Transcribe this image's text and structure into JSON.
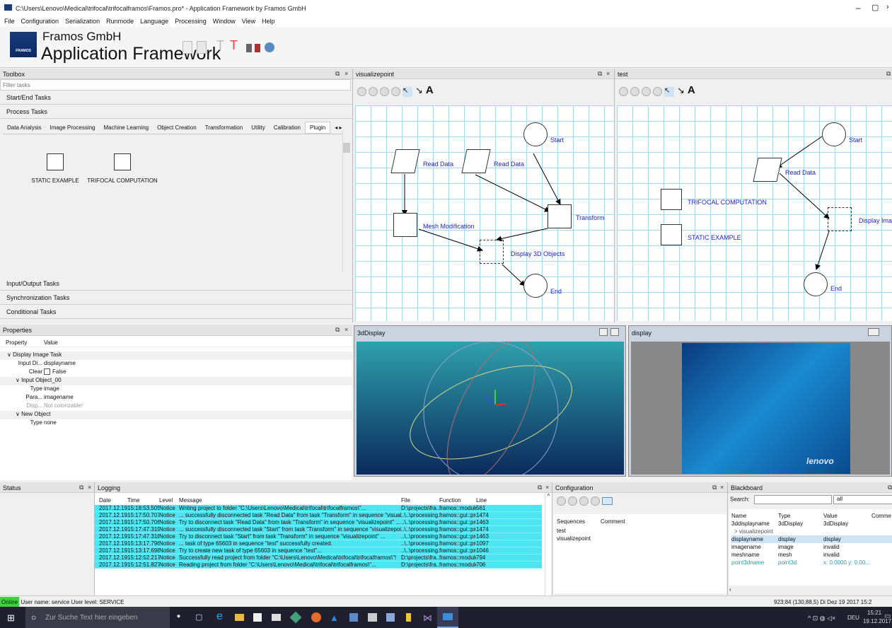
{
  "window": {
    "title": "C:\\Users\\Lenovo\\Medical\\trifocal\\trifocalframos\\Framos.pro* - Application Framework by Framos GmbH"
  },
  "menu": [
    "File",
    "Configuration",
    "Serialization",
    "Runmode",
    "Language",
    "Processing",
    "Window",
    "View",
    "Help"
  ],
  "brand": {
    "company": "Framos GmbH",
    "app": "Application Framework",
    "logo_text": "FRAMOS"
  },
  "toolbox": {
    "title": "Toolbox",
    "filter_placeholder": "Filter tasks",
    "sections": [
      "Start/End Tasks",
      "Process Tasks"
    ],
    "tabs": [
      "Data Analysis",
      "Image Processing",
      "Machine Learning",
      "Object Creation",
      "Transformation",
      "Utility",
      "Calibration",
      "Plugin"
    ],
    "plugins": [
      "STATIC EXAMPLE",
      "TRIFOCAL COMPUTATION"
    ],
    "bottom_sections": [
      "Input/Output Tasks",
      "Synchronization Tasks",
      "Conditional Tasks"
    ]
  },
  "canvas1": {
    "title": "visualizepoint",
    "labels": {
      "start": "Start",
      "read1": "Read Data",
      "read2": "Read Data",
      "transform": "Transform",
      "mesh": "Mesh Modification",
      "display": "Display 3D Objects",
      "end": "End"
    }
  },
  "canvas2": {
    "title": "test",
    "labels": {
      "start": "Start",
      "read": "Read Data",
      "trifocal": "TRIFOCAL COMPUTATION",
      "static": "STATIC EXAMPLE",
      "display": "Display Imag",
      "end": "End"
    }
  },
  "properties": {
    "title": "Properties",
    "col_property": "Property",
    "col_value": "Value",
    "rows": [
      {
        "name": "Display Image Task",
        "value": ""
      },
      {
        "name": "Input Di...",
        "value": "displayname"
      },
      {
        "name": "Clear",
        "value": "False"
      },
      {
        "name": "Input Object_00",
        "value": ""
      },
      {
        "name": "Type",
        "value": "image"
      },
      {
        "name": "Para...",
        "value": "imagename"
      },
      {
        "name": "Disp...",
        "value": "Not colorizable!"
      },
      {
        "name": "New Object",
        "value": ""
      },
      {
        "name": "Type",
        "value": "none"
      }
    ]
  },
  "display3d": {
    "title": "3dDisplay"
  },
  "display2d": {
    "title": "display",
    "brand": "lenovo"
  },
  "status": {
    "title": "Status"
  },
  "logging": {
    "title": "Logging",
    "cols": [
      "Date",
      "Time",
      "Level",
      "Message",
      "File",
      "Function",
      "Line"
    ],
    "rows": [
      [
        "2017.12.19",
        "15:18:53.505",
        "Notice",
        "Writing project to folder \"C:\\Users\\Lenovo\\Medical\\trifocal\\trifocalframos\\\"...",
        "D:\\projects\\fra...",
        "framos::module...",
        "561"
      ],
      [
        "2017.12.19",
        "15:17:50.707",
        "Notice",
        "... successfully disconnected task \"Read Data\" from task \"Transform\" in sequence \"visuali...",
        "..\\..\\processing...",
        "framos::gui::pro...",
        "1474"
      ],
      [
        "2017.12.19",
        "15:17:50.706",
        "Notice",
        "Try to disconnect task \"Read Data\" from task \"Transform\" in sequence \"visualizepoint\" ...",
        "..\\..\\processing...",
        "framos::gui::pro...",
        "1463"
      ],
      [
        "2017.12.19",
        "15:17:47.319",
        "Notice",
        "... successfully disconnected task \"Start\" from task \"Transform\" in sequence \"visualizepoi...",
        "..\\..\\processing...",
        "framos::gui::pro...",
        "1474"
      ],
      [
        "2017.12.19",
        "15:17:47.318",
        "Notice",
        "Try to disconnect task \"Start\" from task \"Transform\" in sequence \"visualizepoint\" ...",
        "..\\..\\processing...",
        "framos::gui::pro...",
        "1463"
      ],
      [
        "2017.12.19",
        "15:13:17.796",
        "Notice",
        "... task of type 65603 in sequence \"test\" successfully created.",
        "..\\..\\processing...",
        "framos::gui::pro...",
        "1097"
      ],
      [
        "2017.12.19",
        "15:13:17.698",
        "Notice",
        "Try to create new task of type 65603 in sequence \"test\"...",
        "..\\..\\processing...",
        "framos::gui::pro...",
        "1046"
      ],
      [
        "2017.12.19",
        "15:12:52.217",
        "Notice",
        "Successfully read project from folder \"C:\\Users\\Lenovo\\Medical\\trifocal\\trifocalframos\\\"!",
        "D:\\projects\\fra...",
        "framos::module...",
        "794"
      ],
      [
        "2017.12.19",
        "15:12:51.827",
        "Notice",
        "Reading project from folder \"C:\\Users\\Lenovo\\Medical\\trifocal\\trifocalframos\\\"...",
        "D:\\projects\\fra...",
        "framos::module...",
        "706"
      ]
    ]
  },
  "configuration": {
    "title": "Configuration",
    "cols": [
      "Sequences",
      "Comment"
    ],
    "rows": [
      "test",
      "visualizepoint"
    ]
  },
  "blackboard": {
    "title": "Blackboard",
    "search_label": "Search:",
    "filter": "all",
    "cols": [
      "Name",
      "Type",
      "Value",
      "Comme"
    ],
    "rows": [
      [
        "3ddisplayname",
        "3dDisplay",
        "3dDisplay"
      ],
      [
        "> visualizepoint",
        "",
        ""
      ],
      [
        "displayname",
        "display",
        "display"
      ],
      [
        "imagename",
        "image",
        "invalid"
      ],
      [
        "meshname",
        "mesh",
        "invalid"
      ],
      [
        "point3dname",
        "point3d",
        "x: 0.0000 y: 0.00..."
      ]
    ]
  },
  "statusbar": {
    "online": "Online",
    "user": "User name: service  User level: SERVICE",
    "coords": "923;84 (130,88,5)  Di Dez 19 2017  15:2"
  },
  "taskbar": {
    "search": "Zur Suche Text hier eingeben",
    "lang": "DEU",
    "time": "15:21",
    "date": "19.12.2017"
  }
}
